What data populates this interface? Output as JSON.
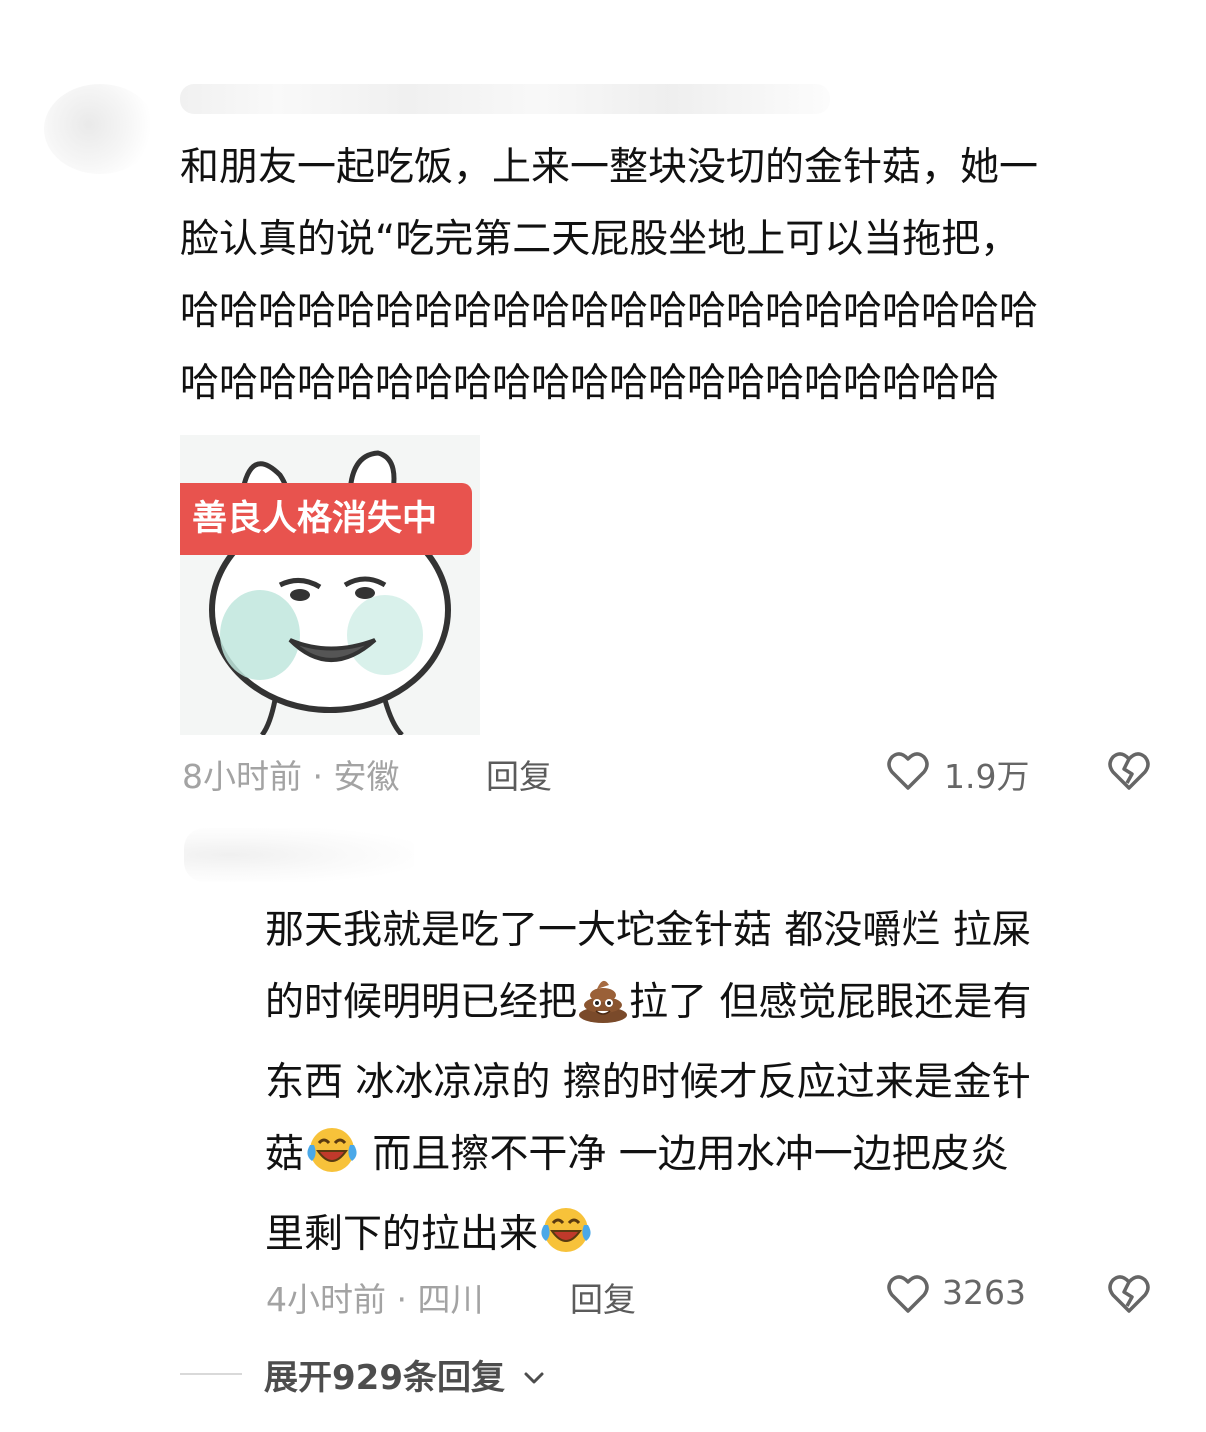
{
  "comments": [
    {
      "lines": [
        "和朋友一起吃饭，上来一整块没切的金针菇，她一",
        "脸认真的说“吃完第二天屁股坐地上可以当拖把，",
        "哈哈哈哈哈哈哈哈哈哈哈哈哈哈哈哈哈哈哈哈哈哈",
        "哈哈哈哈哈哈哈哈哈哈哈哈哈哈哈哈哈哈哈哈哈"
      ],
      "sticker_caption": "善良人格消失中",
      "time_location": "8小时前 · 安徽",
      "reply_label": "回复",
      "like_count": "1.9万"
    },
    {
      "lines": [
        "那天我就是吃了一大坨金针菇  都没嚼烂  拉屎",
        [
          "的时候明明已经把",
          "拉了  但感觉屁眼还是有"
        ],
        "东西  冰冰凉凉的  擦的时候才反应过来是金针",
        [
          "菇",
          "  而且擦不干净  一边用水冲一边把皮炎"
        ],
        [
          "里剩下的拉出来"
        ]
      ],
      "emojis": [
        "poop-emoji",
        "laughing-crying-emoji"
      ],
      "time_location": "4小时前 · 四川",
      "reply_label": "回复",
      "like_count": "3263"
    }
  ],
  "expand_replies": "展开929条回复",
  "colors": {
    "text": "#111111",
    "meta": "#a3a3a3",
    "reply": "#5b5b5b",
    "sticker_banner": "#e8534e"
  }
}
